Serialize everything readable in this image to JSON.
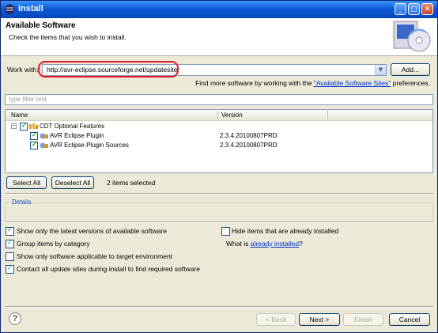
{
  "window": {
    "title": "Install"
  },
  "header": {
    "title": "Available Software",
    "subtitle": "Check the items that you wish to install."
  },
  "work_with": {
    "label": "Work with:",
    "value": "http://avr-eclipse.sourceforge.net/updatesite",
    "add_button": "Add...",
    "more_prefix": "Find more software by working with the ",
    "more_link": "\"Available Software Sites\"",
    "more_suffix": " preferences."
  },
  "filter": {
    "placeholder": "type filter text"
  },
  "tree": {
    "columns": [
      "Name",
      "Version"
    ],
    "rows": [
      {
        "name": "CDT Optional Features",
        "version": "",
        "checked": true,
        "level": 0
      },
      {
        "name": "AVR Eclipse Plugin",
        "version": "2.3.4.20100807PRD",
        "checked": true,
        "level": 1
      },
      {
        "name": "AVR Eclipse Plugin Sources",
        "version": "2.3.4.20100807PRD",
        "checked": true,
        "level": 1
      }
    ]
  },
  "selection": {
    "select_all": "Select All",
    "deselect_all": "Deselect All",
    "count_text": "2 items selected"
  },
  "details": {
    "title": "Details"
  },
  "options": {
    "latest_only": {
      "label": "Show only the latest versions of available software",
      "checked": true
    },
    "group_by_category": {
      "label": "Group items by category",
      "checked": true
    },
    "target_env": {
      "label": "Show only software applicable to target environment",
      "checked": false
    },
    "contact_sites": {
      "label": "Contact all update sites during install to find required software",
      "checked": true
    },
    "hide_installed": {
      "label": "Hide items that are already installed",
      "checked": false
    },
    "what_is_prefix": "What is ",
    "what_is_link": "already installed",
    "what_is_suffix": "?"
  },
  "footer": {
    "back": "< Back",
    "next": "Next >",
    "finish": "Finish",
    "cancel": "Cancel",
    "help": "?"
  },
  "colors": {
    "titlebar": "#0a5bd6",
    "highlight": "#e8141e",
    "link": "#0033cc",
    "check": "#21a121"
  }
}
